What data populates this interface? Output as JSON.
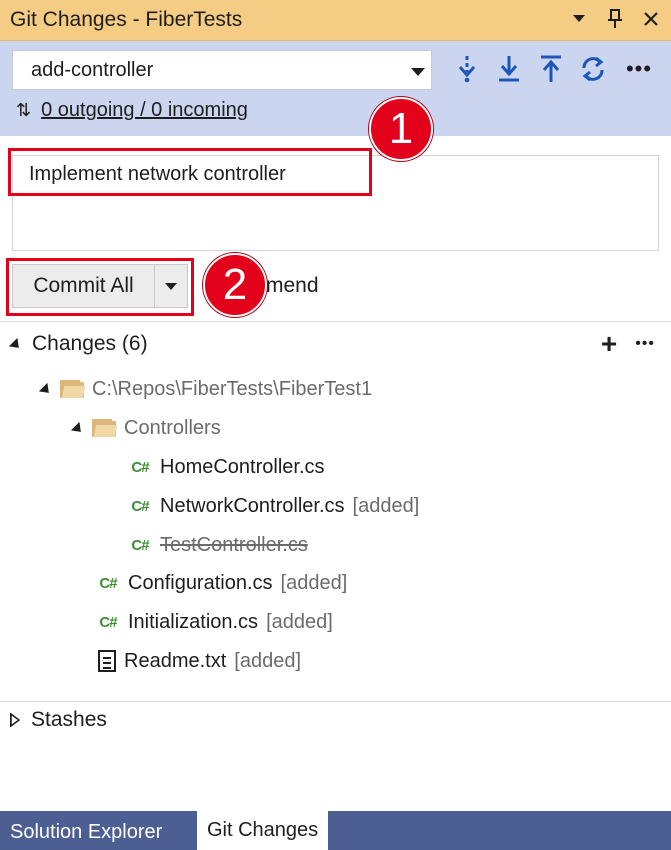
{
  "window": {
    "title": "Git Changes - FiberTests",
    "icons": [
      "dropdown-arrow-icon",
      "pin-icon",
      "close-icon"
    ]
  },
  "branch": {
    "name": "add-controller",
    "sync_text": "0 outgoing / 0 incoming",
    "actions": [
      "fetch-icon",
      "pull-icon",
      "push-icon",
      "sync-icon",
      "more-icon"
    ]
  },
  "commit": {
    "message": "Implement network controller",
    "button_label": "Commit All",
    "amend_label": "mend"
  },
  "badges": {
    "one": "1",
    "two": "2"
  },
  "changes": {
    "header": "Changes (6)",
    "repo_path": "C:\\Repos\\FiberTests\\FiberTest1",
    "folder": "Controllers",
    "controller_files": [
      {
        "name": "HomeController.cs",
        "tag": ""
      },
      {
        "name": "NetworkController.cs",
        "tag": "[added]"
      },
      {
        "name": "TestController.cs",
        "tag": ""
      }
    ],
    "root_files": [
      {
        "name": "Configuration.cs",
        "tag": "[added]"
      },
      {
        "name": "Initialization.cs",
        "tag": "[added]"
      },
      {
        "name": "Readme.txt",
        "tag": "[added]"
      }
    ]
  },
  "stashes": {
    "header": "Stashes"
  },
  "tabs": {
    "solution_explorer": "Solution Explorer",
    "git_changes": "Git Changes"
  },
  "colors": {
    "titlebar": "#f5cc84",
    "branchbar": "#ccd5f0",
    "accent_blue": "#1b57b8",
    "highlight_red": "#e3001b",
    "csharp_green": "#3e8e35",
    "tabbar": "#4d5e92"
  }
}
